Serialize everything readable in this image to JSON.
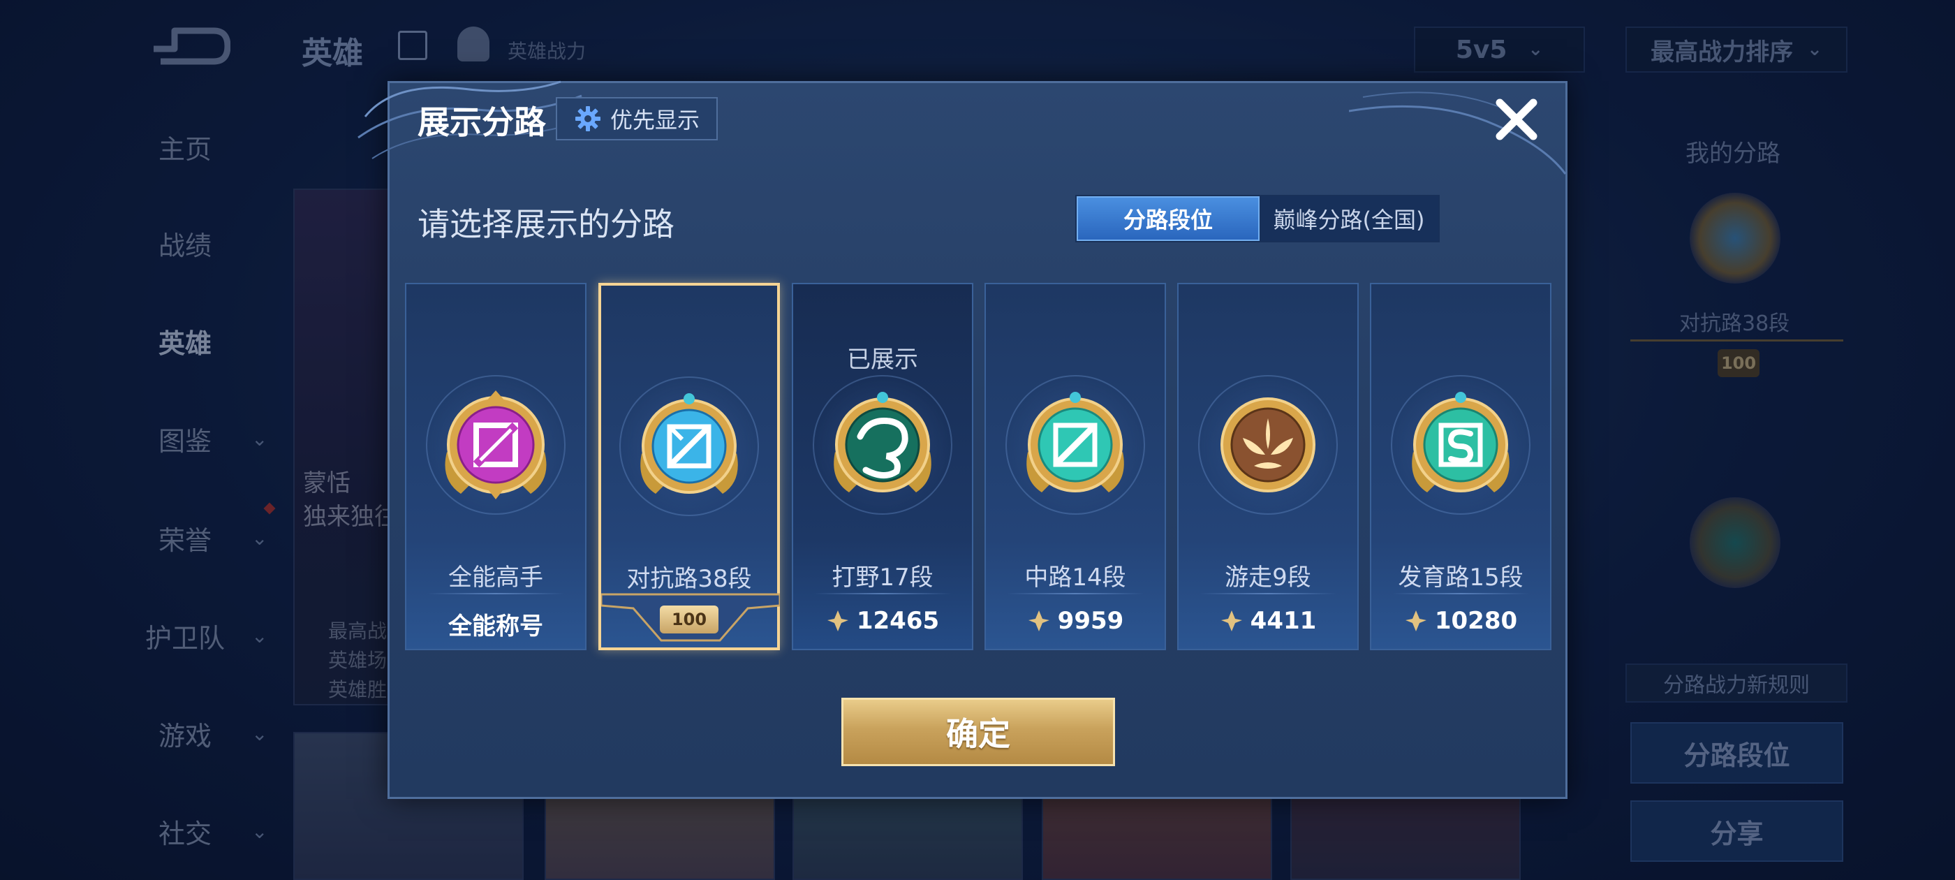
{
  "background": {
    "header": {
      "title": "英雄",
      "sub": "英雄战力"
    },
    "mode_select": "5v5",
    "sort_select": "最高战力排序",
    "sidebar": [
      {
        "label": "主页",
        "has_chevron": false
      },
      {
        "label": "战绩",
        "has_chevron": false
      },
      {
        "label": "英雄",
        "has_chevron": false,
        "active": true
      },
      {
        "label": "图鉴",
        "has_chevron": true
      },
      {
        "label": "荣誉",
        "has_chevron": true
      },
      {
        "label": "护卫队",
        "has_chevron": true
      },
      {
        "label": "游戏",
        "has_chevron": true
      },
      {
        "label": "社交",
        "has_chevron": true
      }
    ],
    "hero_card": {
      "name": "蒙恬",
      "sub": "独来独往",
      "stats": [
        "最高战",
        "英雄场",
        "英雄胜"
      ]
    },
    "right_panel": {
      "title": "我的分路",
      "lane_label": "对抗路38段",
      "lane_plate": "100",
      "rule": "分路战力新规则",
      "btn_lane_rank": "分路段位",
      "btn_share": "分享"
    }
  },
  "modal": {
    "title": "展示分路",
    "priority_button": "优先显示",
    "subtitle": "请选择展示的分路",
    "segments": {
      "active": "分路段位",
      "inactive": "巅峰分路(全国)"
    },
    "lanes": [
      {
        "name": "全能高手",
        "stat": "全能称号",
        "badge": "all-round",
        "color": "#c23cc2",
        "selected": false,
        "shown": false
      },
      {
        "name": "对抗路38段",
        "plate": "100",
        "badge": "clash",
        "color": "#3bb4e8",
        "selected": true,
        "shown": false
      },
      {
        "name": "打野17段",
        "stat": "12465",
        "badge": "jungle",
        "color": "#1a9e8a",
        "selected": false,
        "shown": true,
        "shown_label": "已展示"
      },
      {
        "name": "中路14段",
        "stat": "9959",
        "badge": "mid",
        "color": "#2fc7b4",
        "selected": false,
        "shown": false
      },
      {
        "name": "游走9段",
        "stat": "4411",
        "badge": "roam",
        "color": "#a16a3c",
        "selected": false,
        "shown": false
      },
      {
        "name": "发育路15段",
        "stat": "10280",
        "badge": "farm",
        "color": "#2dbfa3",
        "selected": false,
        "shown": false
      }
    ],
    "confirm": "确定"
  }
}
